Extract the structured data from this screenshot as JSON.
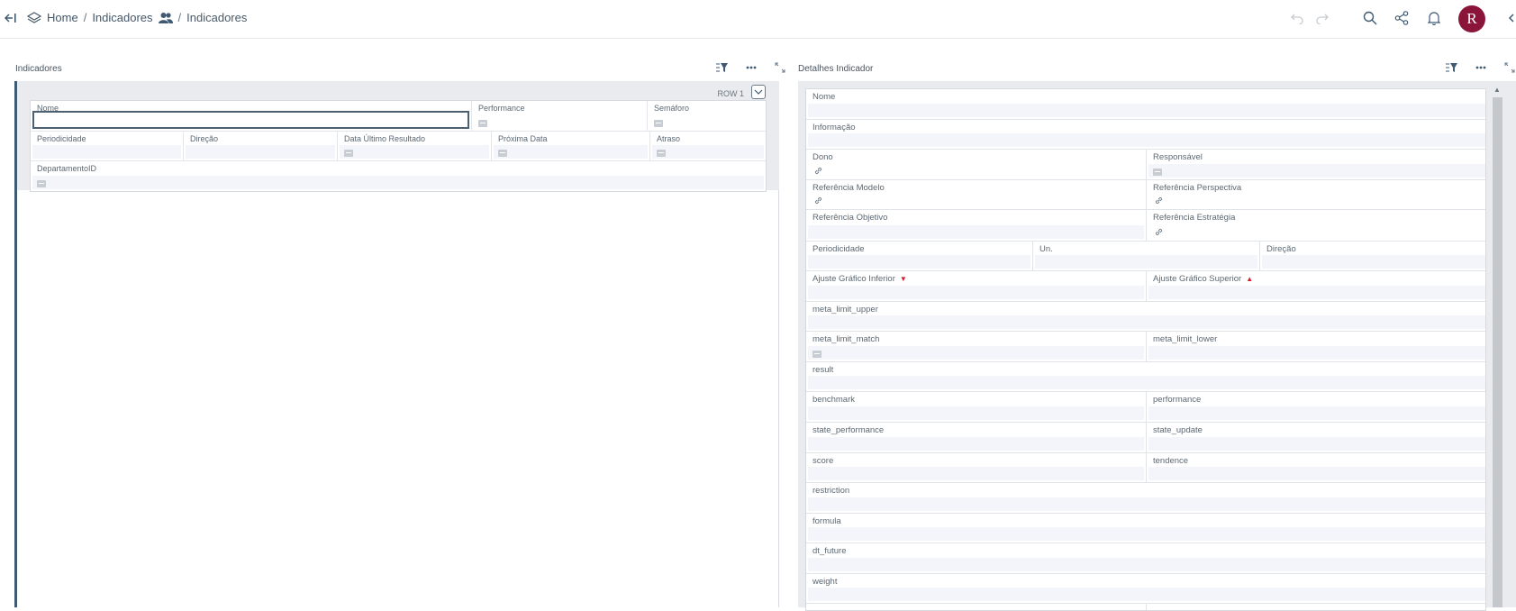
{
  "header": {
    "breadcrumb": [
      {
        "label": "Home"
      },
      {
        "label": "Indicadores"
      },
      {
        "label": "Indicadores"
      }
    ],
    "separator": "/",
    "avatar_letter": "R",
    "avatar_color": "#8a1538",
    "icons": [
      "back-icon",
      "layers-icon",
      "users-icon",
      "undo-icon",
      "redo-icon",
      "search-icon",
      "share-icon",
      "bell-icon",
      "collapse-icon"
    ]
  },
  "left_panel": {
    "title": "Indicadores",
    "row_label": "ROW 1",
    "fields": {
      "nome": "Nome",
      "performance": "Performance",
      "semaforo": "Semáforo",
      "periodicidade": "Periodicidade",
      "direcao": "Direção",
      "data_ultimo": "Data Último Resultado",
      "proxima_data": "Próxima Data",
      "atraso": "Atraso",
      "departamento": "DepartamentoID"
    }
  },
  "right_panel": {
    "title": "Detalhes Indicador",
    "fields": {
      "nome": "Nome",
      "informacao": "Informação",
      "dono": "Dono",
      "responsavel": "Responsável",
      "ref_modelo": "Referência Modelo",
      "ref_perspectiva": "Referência Perspectiva",
      "ref_objetivo": "Referência Objetivo",
      "ref_estrategia": "Referência Estratégia",
      "periodicidade": "Periodicidade",
      "un": "Un.",
      "direcao": "Direção",
      "ajuste_inferior": "Ajuste Gráfico Inferior",
      "ajuste_superior": "Ajuste Gráfico Superior",
      "meta_limit_upper": "meta_limit_upper",
      "meta_limit_match": "meta_limit_match",
      "meta_limit_lower": "meta_limit_lower",
      "result": "result",
      "benchmark": "benchmark",
      "performance": "performance",
      "state_performance": "state_performance",
      "state_update": "state_update",
      "score": "score",
      "tendence": "tendence",
      "restriction": "restriction",
      "formula": "formula",
      "dt_future": "dt_future",
      "weight": "weight"
    },
    "marker_down": "▼",
    "marker_up": "▲",
    "accent_red": "#d02030"
  }
}
